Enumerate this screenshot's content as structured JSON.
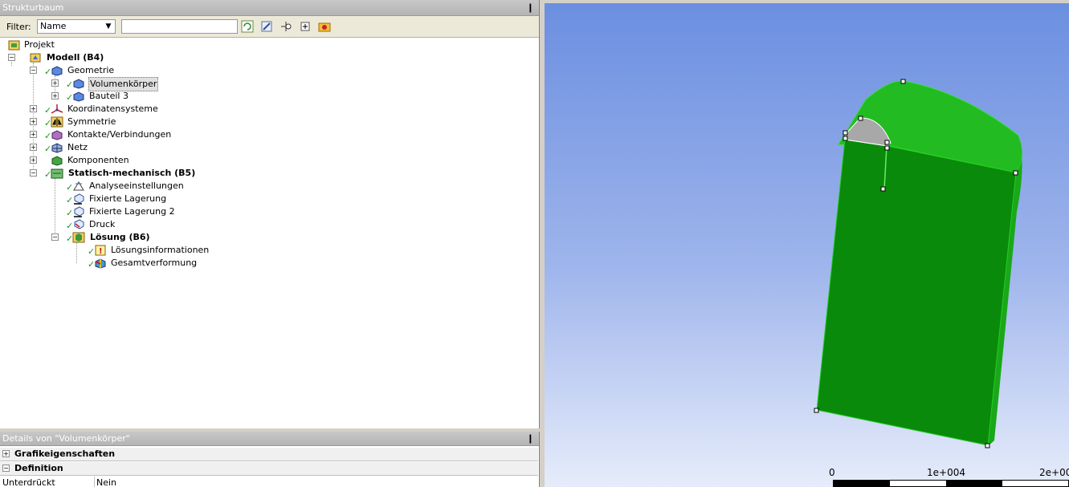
{
  "tree_panel": {
    "title": "Strukturbaum",
    "pin": "❙"
  },
  "filter": {
    "label": "Filter:",
    "selected": "Name",
    "input_value": ""
  },
  "tree": [
    {
      "label": "Projekt",
      "bold": true
    },
    {
      "label": "Modell (B4)",
      "bold": true
    },
    {
      "label": "Geometrie"
    },
    {
      "label": "Volumenkörper",
      "selected": true
    },
    {
      "label": "Bauteil 3"
    },
    {
      "label": "Koordinatensysteme"
    },
    {
      "label": "Symmetrie"
    },
    {
      "label": "Kontakte/Verbindungen"
    },
    {
      "label": "Netz"
    },
    {
      "label": "Komponenten"
    },
    {
      "label": "Statisch-mechanisch (B5)",
      "bold": true
    },
    {
      "label": "Analyseeinstellungen"
    },
    {
      "label": "Fixierte Lagerung"
    },
    {
      "label": "Fixierte Lagerung 2"
    },
    {
      "label": "Druck"
    },
    {
      "label": "Lösung (B6)",
      "bold": true
    },
    {
      "label": "Lösungsinformationen"
    },
    {
      "label": "Gesamtverformung"
    }
  ],
  "details": {
    "title": "Details von \"Volumenkörper\"",
    "groups": [
      {
        "label": "Grafikeigenschaften",
        "expander": "+"
      },
      {
        "label": "Definition",
        "expander": "−"
      }
    ],
    "rows": [
      {
        "key": "Unterdrückt",
        "value": "Nein"
      }
    ]
  },
  "scale": {
    "labels": [
      "0",
      "1e+004",
      "2e+00"
    ]
  },
  "colors": {
    "model_green": "#0a8a0a",
    "model_top": "#22bb22",
    "selection_gray": "#a8a8a8",
    "viewport_top": "#6b8fe0",
    "viewport_bottom": "#e6ecfa"
  }
}
